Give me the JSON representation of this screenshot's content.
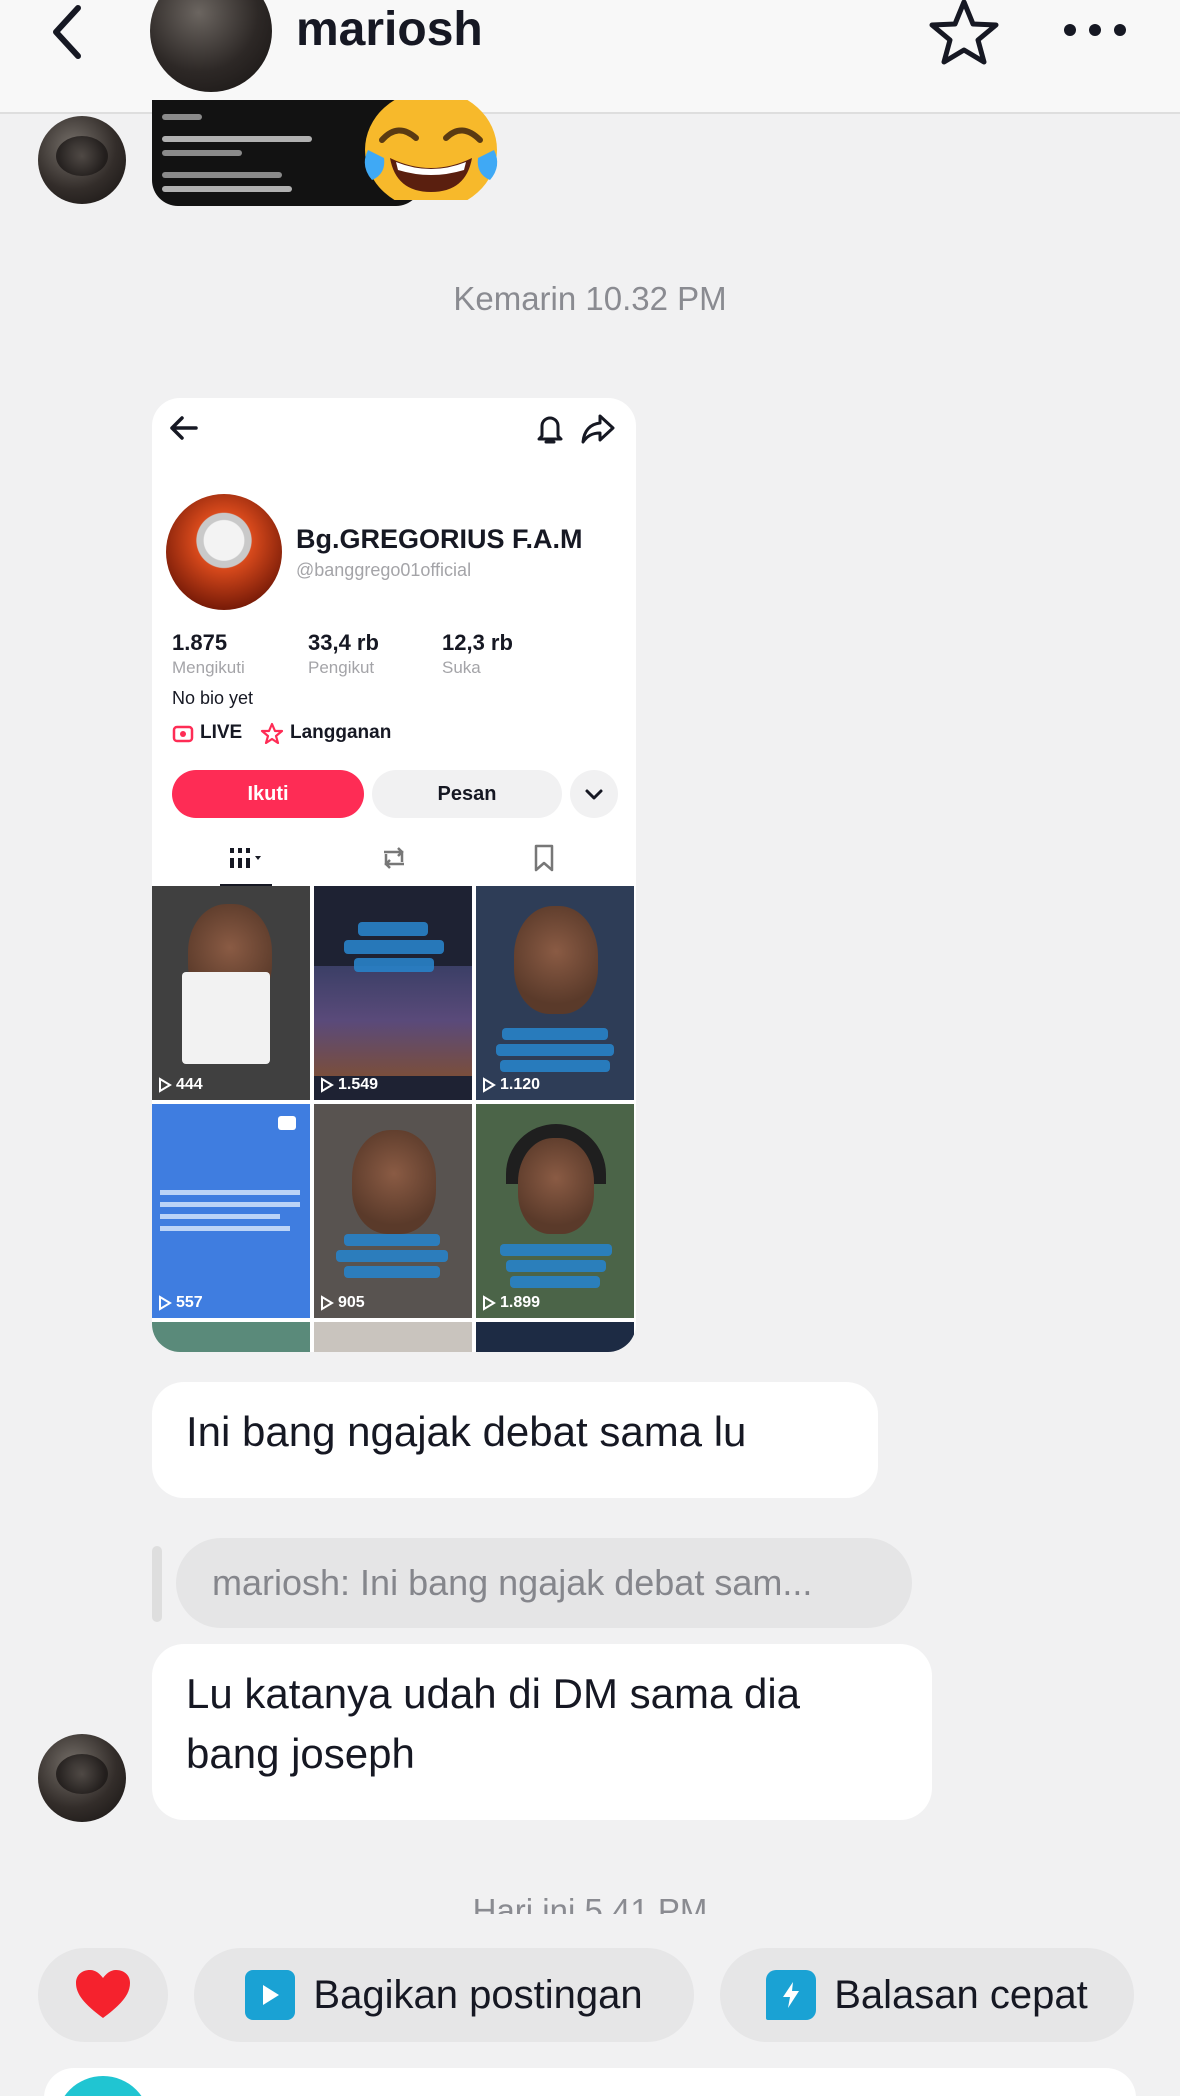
{
  "header": {
    "username": "mariosh"
  },
  "separators": {
    "yesterday": "Kemarin 10.32 PM",
    "today_partial": "Hari ini 5.41 PM"
  },
  "shared_profile": {
    "name": "Bg.GREGORIUS F.A.M",
    "handle": "@banggrego01official",
    "stats": [
      {
        "value": "1.875",
        "label": "Mengikuti"
      },
      {
        "value": "33,4 rb",
        "label": "Pengikut"
      },
      {
        "value": "12,3 rb",
        "label": "Suka"
      }
    ],
    "bio": "No bio yet",
    "live_label": "LIVE",
    "subscription_label": "Langganan",
    "follow_label": "Ikuti",
    "message_label": "Pesan",
    "videos": [
      {
        "views": "444",
        "color": "#3a3a3a"
      },
      {
        "views": "1.549",
        "color": "#2b2f45"
      },
      {
        "views": "1.120",
        "color": "#3d4e6b"
      },
      {
        "views": "557",
        "color": "#3f7de0"
      },
      {
        "views": "905",
        "color": "#5e5a55"
      },
      {
        "views": "1.899",
        "color": "#4d6a48"
      }
    ]
  },
  "messages": {
    "m1": "Ini bang ngajak debat sama lu",
    "reply_preview": "mariosh: Ini bang ngajak debat sam...",
    "m2_line1": "Lu katanya udah di DM sama dia",
    "m2_line2": "bang joseph"
  },
  "quick_actions": {
    "share_post": "Bagikan postingan",
    "quick_reply": "Balasan cepat"
  },
  "colors": {
    "accent": "#fe2c55",
    "bubble": "#ffffff",
    "background": "#f1f1f2",
    "icon_blue": "#1aa2d4"
  }
}
